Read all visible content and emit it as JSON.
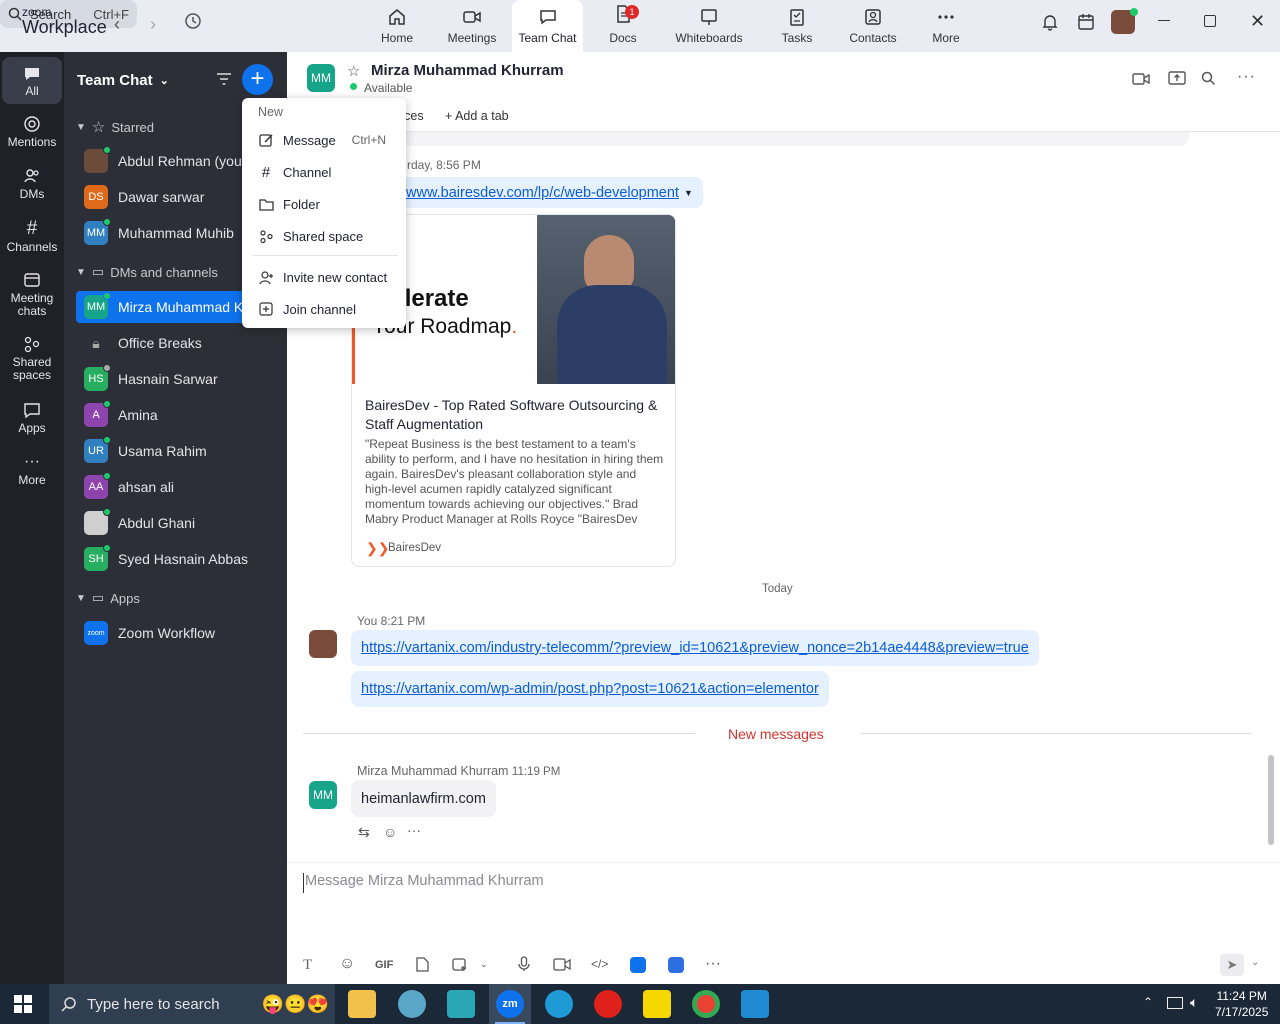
{
  "app": {
    "logo_top": "zoom",
    "logo_bottom": "Workplace"
  },
  "search": {
    "label": "Search",
    "shortcut": "Ctrl+F"
  },
  "topnav": [
    {
      "label": "Home"
    },
    {
      "label": "Meetings"
    },
    {
      "label": "Team Chat"
    },
    {
      "label": "Docs",
      "badge": "1"
    },
    {
      "label": "Whiteboards"
    },
    {
      "label": "Tasks"
    },
    {
      "label": "Contacts"
    },
    {
      "label": "More"
    }
  ],
  "rail": [
    {
      "label": "All"
    },
    {
      "label": "Mentions"
    },
    {
      "label": "DMs"
    },
    {
      "label": "Channels"
    },
    {
      "label": "Meeting chats"
    },
    {
      "label": "Shared spaces"
    },
    {
      "label": "Apps"
    },
    {
      "label": "More"
    }
  ],
  "sidebar": {
    "title": "Team Chat",
    "starred_label": "Starred",
    "starred": [
      {
        "name": "Abdul Rehman (you)",
        "initials": "",
        "color": "#6b4c3b"
      },
      {
        "name": "Dawar sarwar",
        "initials": "DS",
        "color": "#e06a1b"
      },
      {
        "name": "Muhammad Muhib",
        "initials": "MM",
        "color": "#2f7fc1"
      }
    ],
    "dms_label": "DMs and channels",
    "dms": [
      {
        "name": "Mirza Muhammad Khurram",
        "initials": "MM",
        "color": "#17a589"
      },
      {
        "name": "Office Breaks",
        "initials": "",
        "color": ""
      },
      {
        "name": "Hasnain Sarwar",
        "initials": "HS",
        "color": "#27ae60"
      },
      {
        "name": "Amina",
        "initials": "A",
        "color": "#8e44ad"
      },
      {
        "name": "Usama Rahim",
        "initials": "UR",
        "color": "#2f7fc1"
      },
      {
        "name": "ahsan ali",
        "initials": "AA",
        "color": "#8e44ad"
      },
      {
        "name": "Abdul Ghani",
        "initials": "",
        "color": "#cfcfcf"
      },
      {
        "name": "Syed Hasnain Abbas",
        "initials": "SH",
        "color": "#27ae60"
      }
    ],
    "apps_label": "Apps",
    "apps": [
      {
        "name": "Zoom Workflow",
        "initials": "zoom",
        "color": "#0e72ed"
      }
    ]
  },
  "menu": {
    "header": "New",
    "items": [
      {
        "label": "Message",
        "shortcut": "Ctrl+N"
      },
      {
        "label": "Channel"
      },
      {
        "label": "Folder"
      },
      {
        "label": "Shared space"
      },
      {
        "label": "Invite new contact"
      },
      {
        "label": "Join channel"
      }
    ]
  },
  "chat": {
    "initials": "MM",
    "name": "Mirza Muhammad Khurram",
    "status": "Available",
    "tab_partial": "rces",
    "add_tab": "Add a tab",
    "msg1_time": "rday, 8:56 PM",
    "msg1_link": "/www.bairesdev.com/lp/c/web-development",
    "preview": {
      "img_line1": "celerate",
      "img_line2": "Your Roadmap",
      "title": "BairesDev - Top Rated Software Outsourcing & Staff Augmentation",
      "desc": "\"Repeat Business is the best testament to a team's ability to perform, and I have no hesitation in hiring them again. BairesDev's pleasant collaboration style and high-level acumen rapidly catalyzed significant momentum towards achieving our objectives.\" Brad Mabry Product Manager at Rolls Royce \"BairesDev provides amazing",
      "source": "BairesDev"
    },
    "day_divider": "Today",
    "you_label": "You",
    "you_time": "8:21 PM",
    "you_link1": "https://vartanix.com/industry-telecomm/?preview_id=10621&preview_nonce=2b14ae4448&preview=true",
    "you_link2": "https://vartanix.com/wp-admin/post.php?post=10621&action=elementor",
    "new_messages": "New messages",
    "their_name": "Mirza Muhammad Khurram",
    "their_time": "11:19 PM",
    "their_msg": "heimanlawfirm.com",
    "composer_placeholder": "Message Mirza Muhammad Khurram",
    "gif_label": "GIF"
  },
  "taskbar": {
    "search": "Type here to search",
    "time": "11:24 PM",
    "date": "7/17/2025"
  }
}
